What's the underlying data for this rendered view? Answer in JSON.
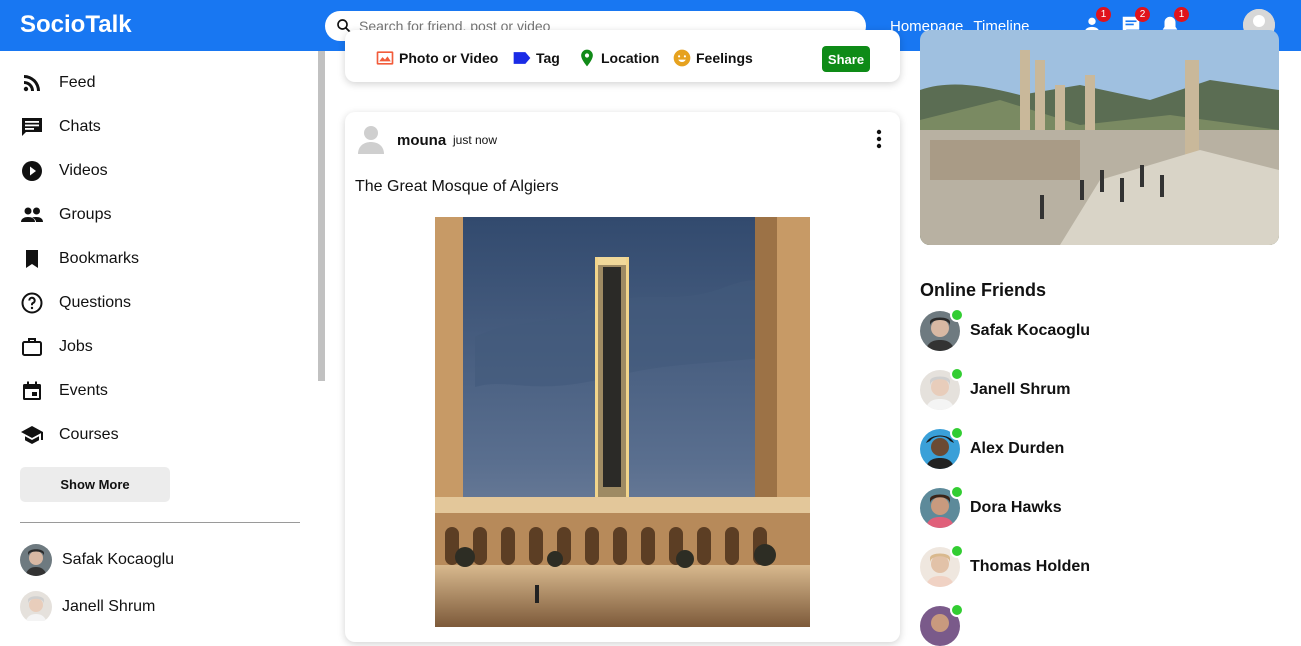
{
  "topbar": {
    "logo": "SocioTalk",
    "search_placeholder": "Search for friend, post or video",
    "links": [
      "Homepage",
      "Timeline"
    ],
    "badges": {
      "friends": "1",
      "chats": "2",
      "notifications": "1"
    },
    "brand_color": "#1877f2"
  },
  "sidebar": {
    "items": [
      {
        "label": "Feed",
        "icon": "rss-feed-icon"
      },
      {
        "label": "Chats",
        "icon": "chat-icon"
      },
      {
        "label": "Videos",
        "icon": "play-circle-icon"
      },
      {
        "label": "Groups",
        "icon": "group-icon"
      },
      {
        "label": "Bookmarks",
        "icon": "bookmark-icon"
      },
      {
        "label": "Questions",
        "icon": "help-circle-icon"
      },
      {
        "label": "Jobs",
        "icon": "work-icon"
      },
      {
        "label": "Events",
        "icon": "event-icon"
      },
      {
        "label": "Courses",
        "icon": "school-icon"
      }
    ],
    "show_more": "Show More",
    "friends": [
      "Safak Kocaoglu",
      "Janell Shrum"
    ]
  },
  "share": {
    "options": [
      "Photo or Video",
      "Tag",
      "Location",
      "Feelings"
    ],
    "button": "Share"
  },
  "post": {
    "username": "mouna",
    "time": "just now",
    "text": "The Great Mosque of Algiers"
  },
  "rightbar": {
    "online_title": "Online Friends",
    "online_friends": [
      "Safak Kocaoglu",
      "Janell Shrum",
      "Alex Durden",
      "Dora Hawks",
      "Thomas Holden"
    ]
  }
}
